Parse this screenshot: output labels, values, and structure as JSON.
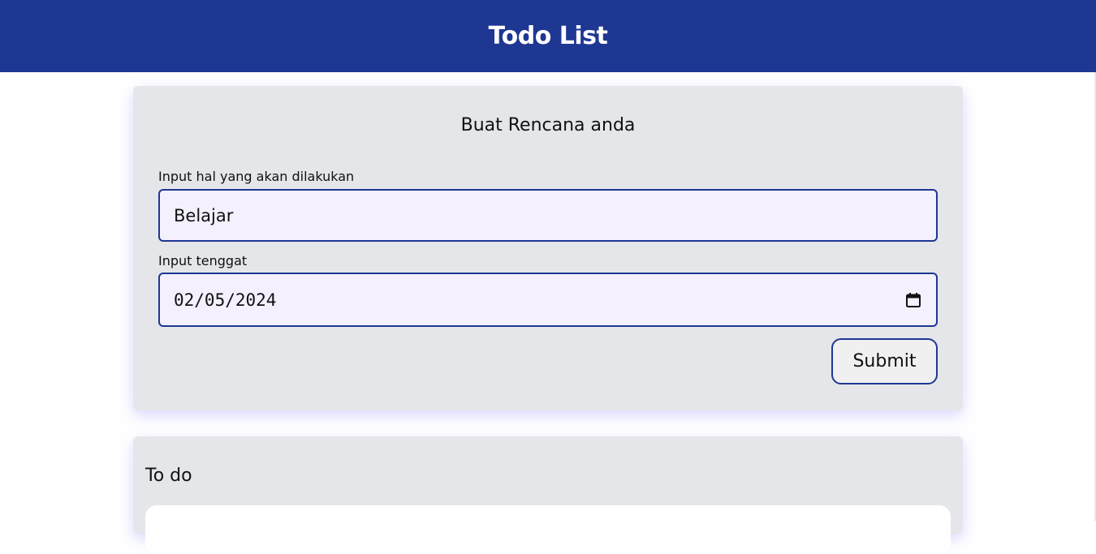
{
  "header": {
    "title": "Todo List"
  },
  "form": {
    "title": "Buat Rencana anda",
    "todo_label": "Input hal yang akan dilakukan",
    "todo_value": "Belajar",
    "deadline_label": "Input tenggat",
    "deadline_value": "02/05/2024",
    "submit_label": "Submit"
  },
  "todo_section": {
    "title": "To do"
  },
  "icons": {
    "date_picker": "calendar-icon"
  },
  "colors": {
    "header_bg": "#1e3793",
    "accent_border": "#1e3793",
    "card_bg": "#e4e6e9",
    "input_bg": "#f4f0fe"
  }
}
